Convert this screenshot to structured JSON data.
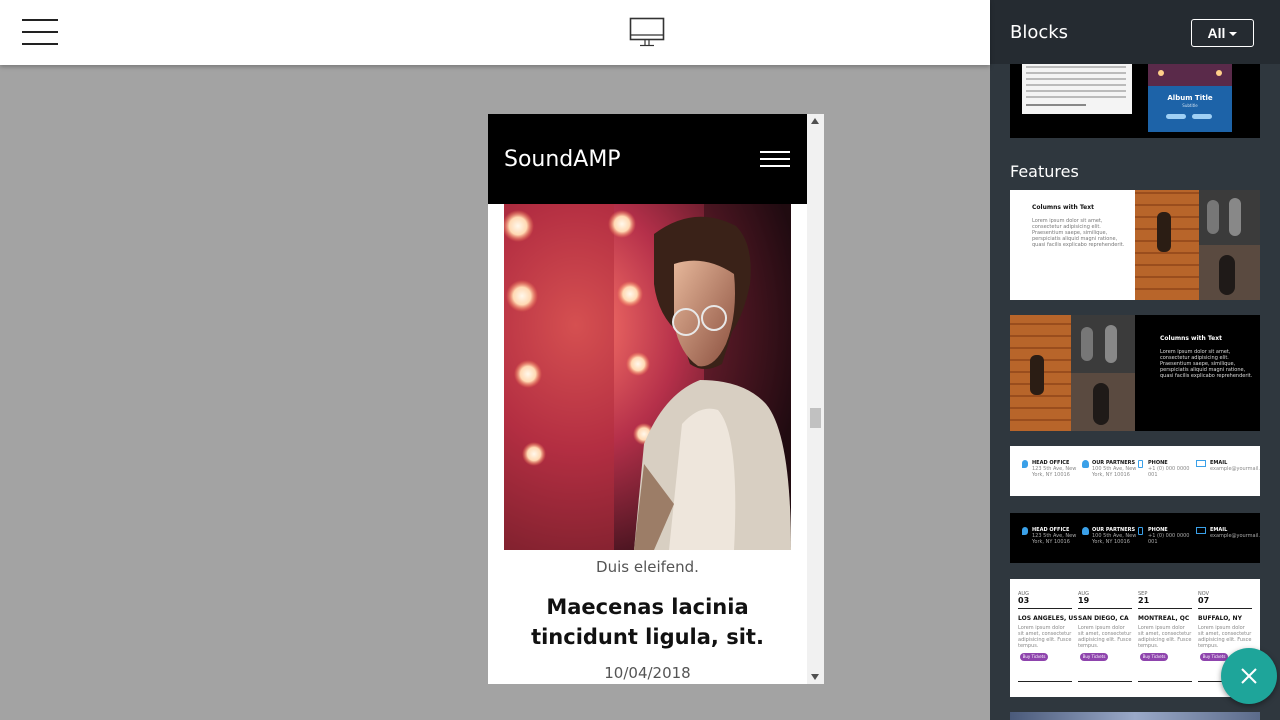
{
  "toolbar": {
    "menu_icon": "hamburger-menu-icon",
    "view_icon": "desktop-monitor-icon"
  },
  "preview": {
    "brand": "SoundAMP",
    "menu_icon": "hamburger-menu-icon",
    "card": {
      "image_icon": "photo-man-with-glasses",
      "category": "Duis eleifend.",
      "title": "Maecenas lacinia tincidunt ligula, sit.",
      "date": "10/04/2018"
    }
  },
  "panel": {
    "title": "Blocks",
    "filter_label": "All",
    "album_thumb": {
      "title": "Album Title",
      "subtitle": "Subtitle"
    },
    "features_label": "Features",
    "columns_light": {
      "heading": "Columns with Text",
      "body": "Lorem ipsum dolor sit amet, consectetur adipisicing elit. Praesentium saepe, similique, perspiciatis aliquid magni ratione, quasi facilis explicabo reprehenderit."
    },
    "columns_dark": {
      "heading": "Columns with Text",
      "body": "Lorem ipsum dolor sit amet, consectetur adipisicing elit. Praesentium saepe, similique, perspiciatis aliquid magni ratione, quasi facilis explicabo reprehenderit."
    },
    "contacts_light": [
      {
        "label": "HEAD OFFICE",
        "text": "123 5th Ave, New York, NY 10016"
      },
      {
        "label": "OUR PARTNERS",
        "text": "100 5th Ave, New York, NY 10016"
      },
      {
        "label": "PHONE",
        "text": "+1 (0) 000 0000 001"
      },
      {
        "label": "EMAIL",
        "text": "example@yourmail.com"
      }
    ],
    "contacts_dark": [
      {
        "label": "HEAD OFFICE",
        "text": "123 5th Ave, New York, NY 10016"
      },
      {
        "label": "OUR PARTNERS",
        "text": "100 5th Ave, New York, NY 10016"
      },
      {
        "label": "PHONE",
        "text": "+1 (0) 000 0000 001"
      },
      {
        "label": "EMAIL",
        "text": "example@yourmail.com"
      }
    ],
    "events": [
      {
        "month": "AUG",
        "day": "03",
        "city": "LOS ANGELES, US",
        "button": "Buy Tickets"
      },
      {
        "month": "AUG",
        "day": "19",
        "city": "SAN DIEGO, CA",
        "button": "Buy Tickets"
      },
      {
        "month": "SEP",
        "day": "21",
        "city": "MONTREAL, QC",
        "button": "Buy Tickets"
      },
      {
        "month": "NOV",
        "day": "07",
        "city": "BUFFALO, NY",
        "button": "Buy Tickets"
      }
    ],
    "event_desc": "Lorem ipsum dolor sit amet, consectetur adipisicing elit. Fusce tempus.",
    "close_icon": "close-icon"
  },
  "colors": {
    "canvas": "#a3a3a3",
    "panel": "#2f373e",
    "panel_header": "#252b31",
    "fab": "#1ea59a",
    "event_button": "#8e44ad"
  }
}
